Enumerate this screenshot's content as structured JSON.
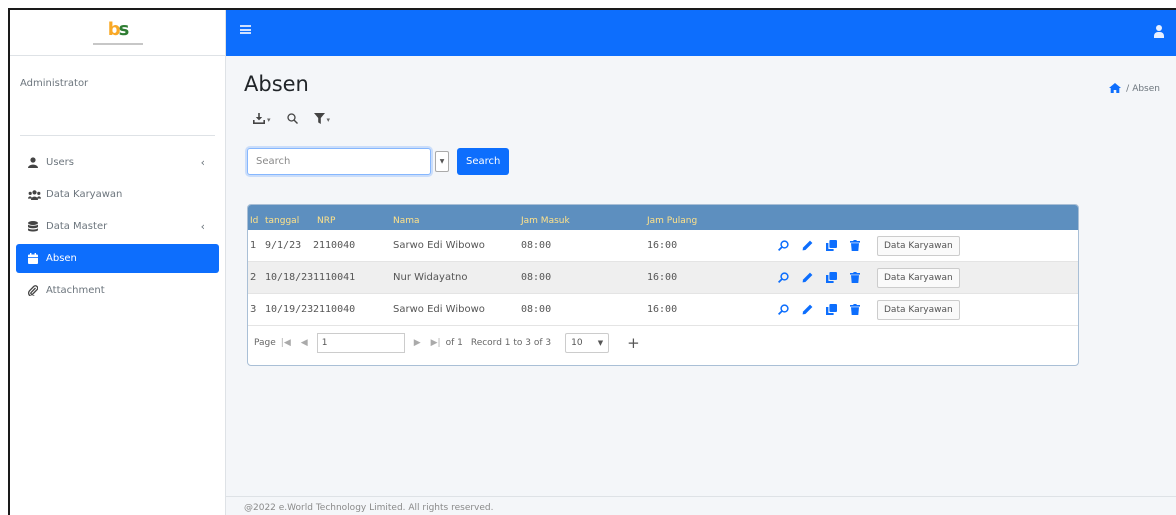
{
  "sidebar": {
    "user_name": "Administrator",
    "items": [
      {
        "label": "Users",
        "icon": "user-icon",
        "has_caret": true,
        "active": false
      },
      {
        "label": "Data Karyawan",
        "icon": "users-icon",
        "has_caret": false,
        "active": false
      },
      {
        "label": "Data Master",
        "icon": "database-icon",
        "has_caret": true,
        "active": false
      },
      {
        "label": "Absen",
        "icon": "calendar-icon",
        "has_caret": false,
        "active": true
      },
      {
        "label": "Attachment",
        "icon": "paperclip-icon",
        "has_caret": false,
        "active": false
      }
    ],
    "caret_glyph": "‹"
  },
  "main": {
    "title": "Absen",
    "breadcrumb": {
      "separator": "/",
      "current": "Absen"
    }
  },
  "search": {
    "placeholder": "Search",
    "button_label": "Search"
  },
  "grid": {
    "columns": [
      "Id",
      "tanggal",
      "NRP",
      "Nama",
      "Jam Masuk",
      "Jam Pulang"
    ],
    "rows": [
      {
        "id": "1",
        "tanggal": "9/1/23",
        "nrp": "2110040",
        "nama": "Sarwo Edi Wibowo",
        "jam_masuk": "08:00",
        "jam_pulang": "16:00",
        "action_label": "Data Karyawan"
      },
      {
        "id": "2",
        "tanggal": "10/18/23",
        "nrp": "1110041",
        "nama": "Nur Widayatno",
        "jam_masuk": "08:00",
        "jam_pulang": "16:00",
        "action_label": "Data Karyawan"
      },
      {
        "id": "3",
        "tanggal": "10/19/23",
        "nrp": "2110040",
        "nama": "Sarwo Edi Wibowo",
        "jam_masuk": "08:00",
        "jam_pulang": "16:00",
        "action_label": "Data Karyawan"
      }
    ]
  },
  "pager": {
    "page_label": "Page",
    "page_value": "1",
    "of_label": "of 1",
    "record_label": "Record 1 to 3 of 3",
    "page_size": "10",
    "add_glyph": "+"
  },
  "footer": {
    "text": "@2022 e.World Technology Limited. All rights reserved."
  },
  "colors": {
    "primary": "#0d6efd",
    "grid_header": "#5d8fbf",
    "grid_header_text": "#ffe28a"
  }
}
